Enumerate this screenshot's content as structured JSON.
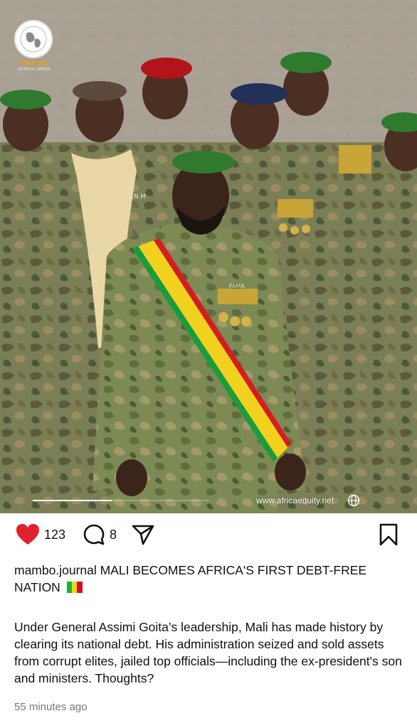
{
  "post": {
    "image_alt_icon": "group-photo",
    "watermark": "www.africaequity.net",
    "watermark_icon": "globe-icon",
    "logo": {
      "brand": "MAMBO",
      "sub": "EDTECH | MEDIA",
      "icon": "globe-icon"
    },
    "uniform_text": {
      "gnm": "G.N.M",
      "fama": "FAMA"
    },
    "progress": 0.45
  },
  "actions": {
    "likes": "123",
    "comments": "8",
    "like_color": "#e0222f"
  },
  "caption": {
    "username": "mambo.journal",
    "headline": "MALI BECOMES AFRICA'S FIRST DEBT-FREE NATION",
    "flag_colors": [
      "#14b53a",
      "#fcd116",
      "#ce1126"
    ]
  },
  "body": "Under General Assimi Goita’s leadership, Mali has made history by clearing its national debt. His administration seized and sold assets from corrupt elites, jailed top officials—including the ex-president's son and ministers. Thoughts?",
  "timestamp": "55 minutes ago"
}
